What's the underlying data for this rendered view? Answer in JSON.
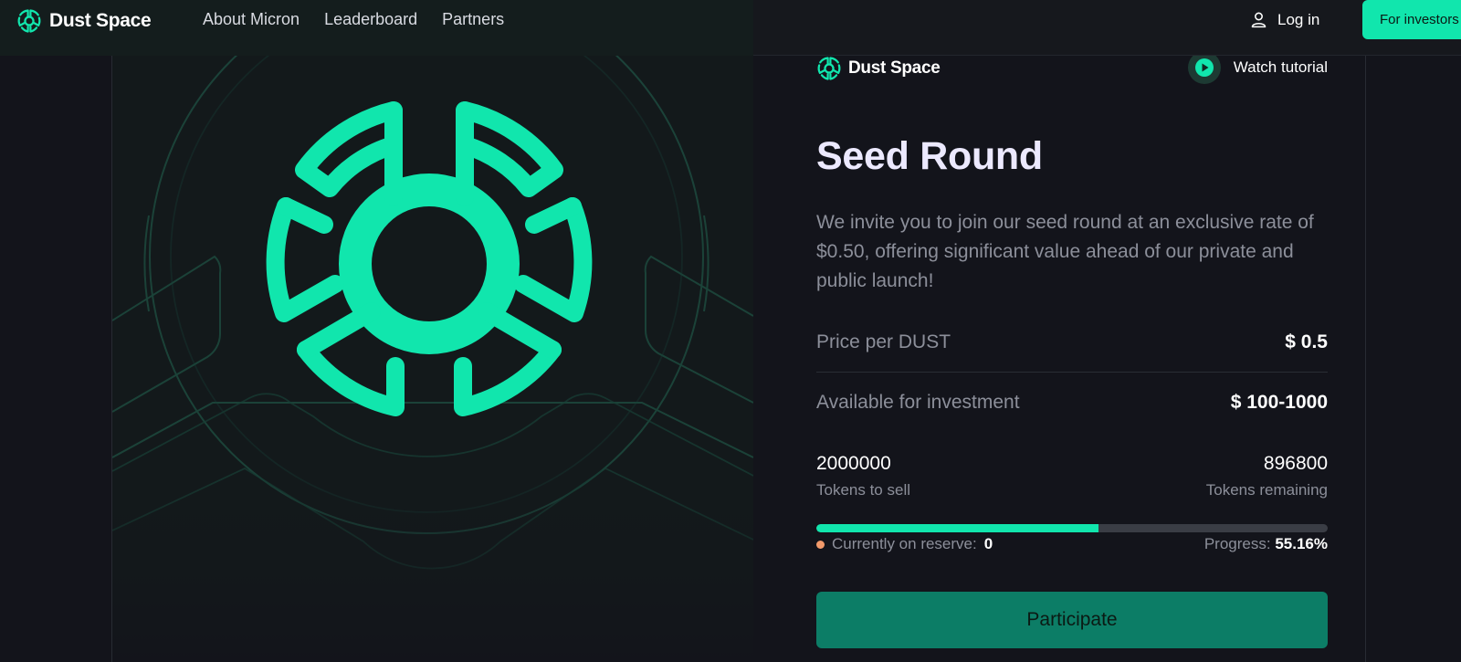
{
  "header": {
    "brand": "Dust Space",
    "nav": [
      "About Micron",
      "Leaderboard",
      "Partners"
    ],
    "login": "Log in",
    "investor_button": "For investors"
  },
  "panel": {
    "brand": "Dust Space",
    "tutorial": "Watch tutorial",
    "title": "Seed Round",
    "description": "We invite you to join our seed round at an exclusive rate of $0.50, offering significant value ahead of our private and public launch!",
    "price_label": "Price per DUST",
    "price_value": "$ 0.5",
    "available_label": "Available for investment",
    "available_value": "$ 100-1000",
    "tokens_to_sell": "2000000",
    "tokens_to_sell_label": "Tokens to sell",
    "tokens_remaining": "896800",
    "tokens_remaining_label": "Tokens remaining",
    "progress_fraction": 0.5516,
    "reserve_label": "Currently on reserve:",
    "reserve_value": "0",
    "progress_label": "Progress:",
    "progress_value": "55.16%",
    "participate": "Participate"
  },
  "colors": {
    "accent": "#11e6ad",
    "button": "#0c7d66",
    "background": "#13141b",
    "reserve_dot": "#f29a6b"
  },
  "icons": [
    "dust-space-logo-icon",
    "user-icon",
    "play-icon"
  ]
}
